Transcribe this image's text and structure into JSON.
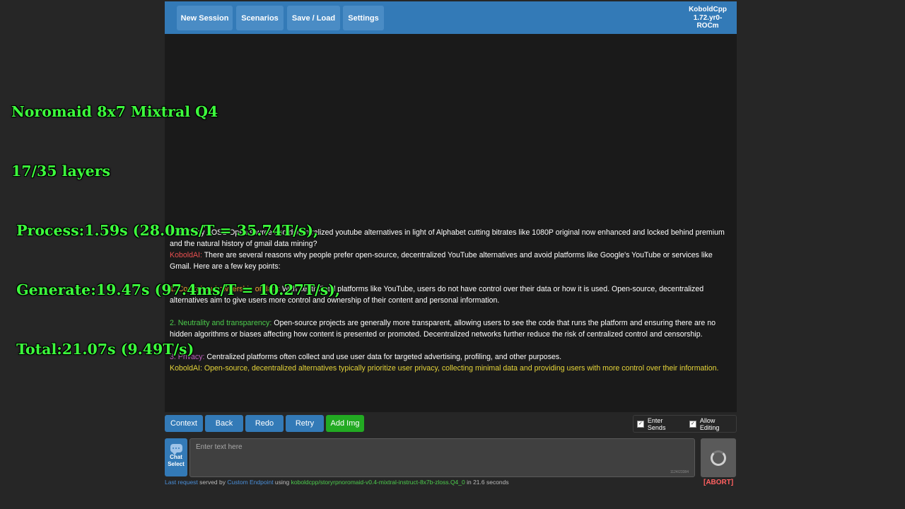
{
  "topbar": {
    "buttons": [
      "New Session",
      "Scenarios",
      "Save / Load",
      "Settings"
    ],
    "brand_lines": [
      "KoboldCpp",
      "1.72.yr0-",
      "ROCm"
    ]
  },
  "overlay": {
    "lines": [
      "Noromaid 8x7 Mixtral Q4",
      "17/35 layers",
      " Process:1.59s (28.0ms/T = 35.74T/s),",
      " Generate:19.47s (97.4ms/T = 10.27T/s),",
      " Total:21.07s (9.49T/s)"
    ]
  },
  "chat": {
    "user_label": "User:",
    "user_text": " Why FOSS Open source and decentralized youtube alternatives in light of Alphabet cutting bitrates like 1080P original now enhanced and locked behind premium and the natural history of gmail data mining?",
    "ai_label": "KoboldAI:",
    "ai_text": " There are several reasons why people prefer open-source, decentralized YouTube alternatives and avoid platforms like Google's YouTube or services like Gmail. Here are a few key points:",
    "point1_label": "1. Control and ownership of data:",
    "point1_text": " With centralized platforms like YouTube, users do not have control over their data or how it is used. Open-source, decentralized alternatives aim to give users more control and ownership of their content and personal information.",
    "point2_label": "2. Neutrality and transparency:",
    "point2_text": " Open-source projects are generally more transparent, allowing users to see the code that runs the platform and ensuring there are no hidden algorithms or biases affecting how content is presented or promoted. Decentralized networks further reduce the risk of centralized control and censorship.",
    "point3_label": "3. Privacy:",
    "point3_text": " Centralized platforms often collect and use user data for targeted advertising, profiling, and other purposes.",
    "pending_text": "KoboldAI: Open-source, decentralized alternatives typically prioritize user privacy, collecting minimal data and providing users with more control over their information."
  },
  "actions": {
    "buttons": [
      "Context",
      "Back",
      "Redo",
      "Retry",
      "Add Img"
    ],
    "enter_sends_label": "Enter Sends",
    "allow_editing_label": "Allow Editing",
    "enter_sends_checked": true,
    "allow_editing_checked": true
  },
  "input": {
    "chat_select_line1": "Chat",
    "chat_select_line2": "Select",
    "placeholder": "Enter text here",
    "counter": "1124/23384"
  },
  "status": {
    "last_request": "Last request",
    "served_by": " served by ",
    "endpoint": "Custom Endpoint",
    "using": " using ",
    "model": "koboldcpp/storyrpnoromaid-v0.4-mixtral-instruct-8x7b-zloss.Q4_0",
    "duration": " in 21.6 seconds",
    "abort": "[ABORT]"
  },
  "colors": {
    "accent": "#337ab7",
    "add_img": "#22aa22",
    "overlay_text": "#3dff3d",
    "user_label": "#8b8bff",
    "ai_label": "#e85050",
    "pending_text": "#e6d53a"
  }
}
